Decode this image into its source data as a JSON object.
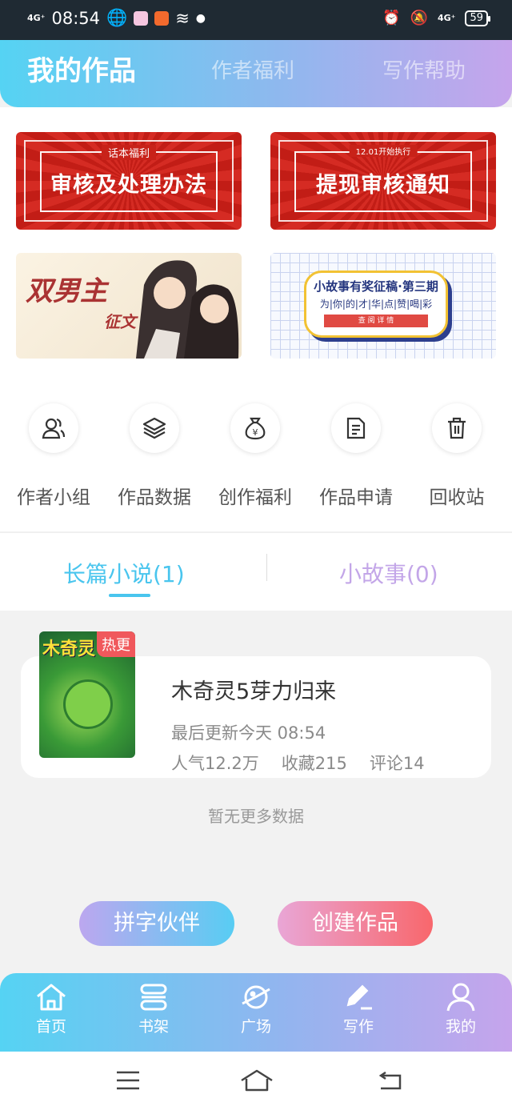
{
  "status_bar": {
    "signal_left": "4G⁺",
    "time": "08:54",
    "signal_right": "4G⁺",
    "battery": "59"
  },
  "header": {
    "tabs": [
      {
        "label": "我的作品",
        "active": true
      },
      {
        "label": "作者福利",
        "active": false
      },
      {
        "label": "写作帮助",
        "active": false
      }
    ]
  },
  "banners": {
    "notice1": {
      "tag": "话本福利",
      "title": "审核及处理办法"
    },
    "notice2": {
      "tag": "12.01开始执行",
      "title": "提现审核通知"
    },
    "contest": {
      "word": "双男主",
      "sub": "征文"
    },
    "story": {
      "title": "小故事有奖征稿·第三期",
      "sub": "为|你|的|才|华|点|赞|喝|彩",
      "button": "查 阅 详 情"
    }
  },
  "quick_actions": [
    {
      "label": "作者小组",
      "icon": "group-icon"
    },
    {
      "label": "作品数据",
      "icon": "layers-icon"
    },
    {
      "label": "创作福利",
      "icon": "money-bag-icon"
    },
    {
      "label": "作品申请",
      "icon": "document-icon"
    },
    {
      "label": "回收站",
      "icon": "trash-icon"
    }
  ],
  "work_tabs": {
    "novel": "长篇小说(1)",
    "story": "小故事(0)"
  },
  "work": {
    "badge": "热更",
    "cover_text": "木奇灵",
    "title": "木奇灵5芽力归来",
    "updated": "最后更新今天 08:54",
    "popularity": "人气12.2万",
    "favorites": "收藏215",
    "comments": "评论14"
  },
  "no_more": "暂无更多数据",
  "actions": {
    "partner": "拼字伙伴",
    "create": "创建作品"
  },
  "tabbar": [
    {
      "label": "首页",
      "icon": "home-icon"
    },
    {
      "label": "书架",
      "icon": "bookshelf-icon"
    },
    {
      "label": "广场",
      "icon": "planet-icon"
    },
    {
      "label": "写作",
      "icon": "pen-icon"
    },
    {
      "label": "我的",
      "icon": "profile-icon"
    }
  ],
  "colors": {
    "accent_blue": "#49c5ee",
    "accent_purple": "#c6a4ec",
    "create_red": "#f8676c"
  }
}
